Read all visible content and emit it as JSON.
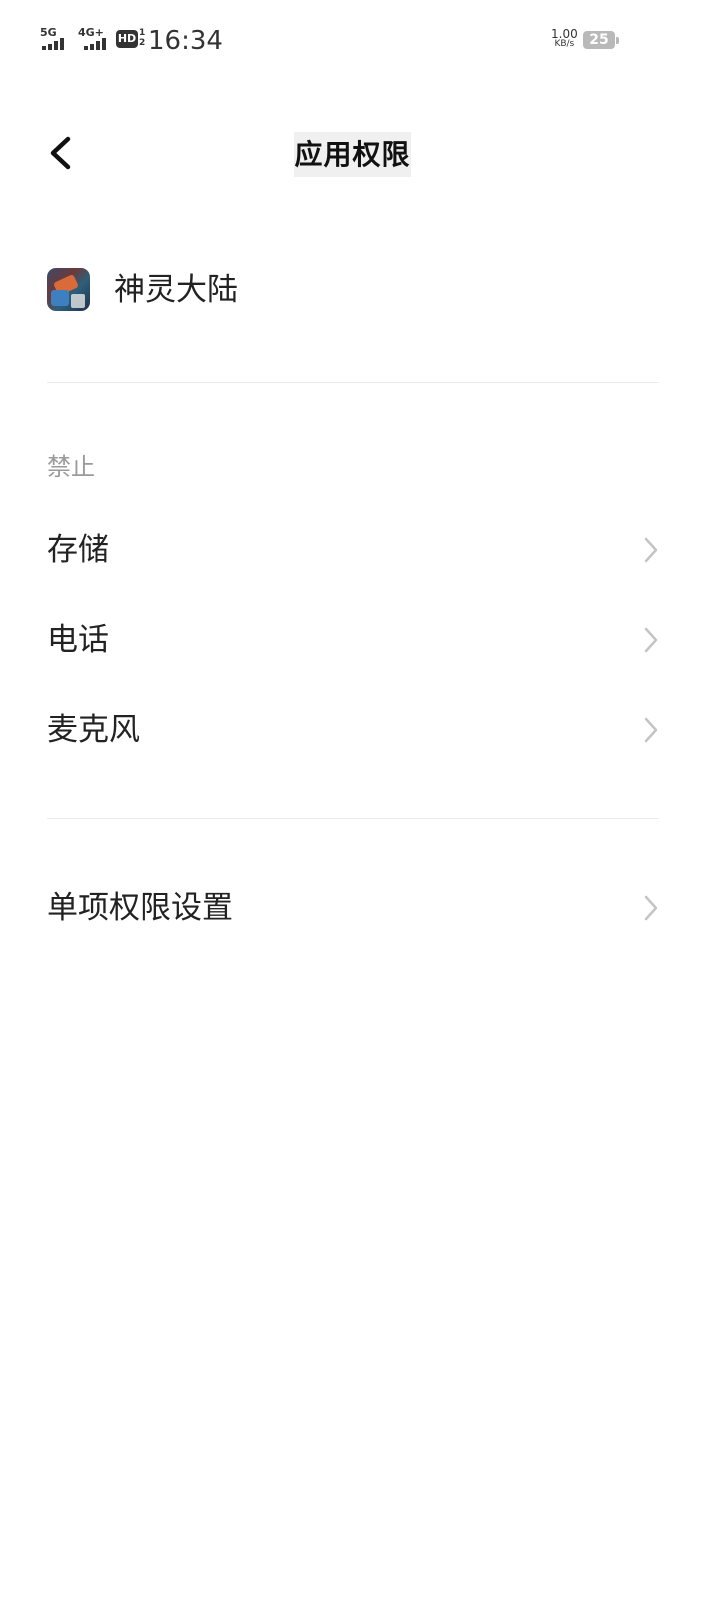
{
  "status_bar": {
    "signal_1_label": "5G",
    "signal_2_label": "4G+",
    "hd_label": "HD",
    "hd_sub_top": "1",
    "hd_sub_bottom": "2",
    "time": "16:34",
    "net_speed_value": "1.00",
    "net_speed_unit": "KB/s",
    "battery_level": "25"
  },
  "header": {
    "back_icon": "chevron-left-icon",
    "title": "应用权限"
  },
  "app": {
    "name": "神灵大陆",
    "icon": "app-icon"
  },
  "permissions": {
    "section_label": "禁止",
    "items": [
      {
        "label": "存储"
      },
      {
        "label": "电话"
      },
      {
        "label": "麦克风"
      }
    ]
  },
  "single_settings": {
    "label": "单项权限设置"
  },
  "colors": {
    "background": "#ffffff",
    "text_primary": "#222222",
    "text_secondary": "#9a9a9a",
    "chevron": "#c4c4c4",
    "divider": "#ececec"
  }
}
